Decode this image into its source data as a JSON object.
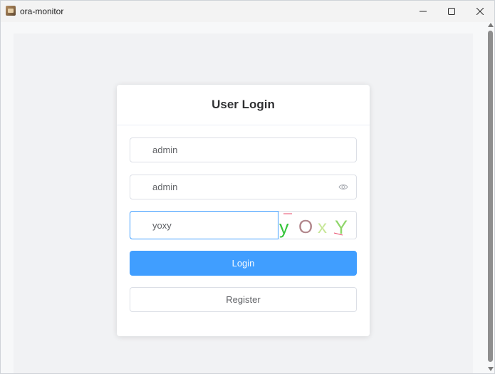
{
  "window": {
    "title": "ora-monitor",
    "app_icon": "app-icon",
    "controls": {
      "minimize_icon": "minimize-icon",
      "maximize_icon": "maximize-icon",
      "close_icon": "close-icon"
    }
  },
  "login": {
    "title": "User Login",
    "username_value": "admin",
    "password_value": "admin",
    "captcha_value": "yoxy",
    "captcha_image_text": [
      "y",
      "O",
      "x",
      "Y"
    ],
    "login_label": "Login",
    "register_label": "Register"
  },
  "colors": {
    "primary": "#409eff",
    "border": "#dcdfe6",
    "title_text": "#303133",
    "body_text": "#606266"
  }
}
